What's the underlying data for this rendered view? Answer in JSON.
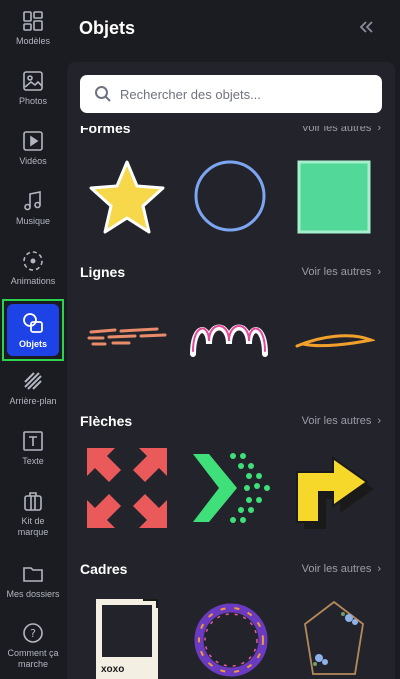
{
  "rail": [
    {
      "label": "Modèles",
      "icon": "grid-icon"
    },
    {
      "label": "Photos",
      "icon": "image-icon"
    },
    {
      "label": "Vidéos",
      "icon": "play-icon"
    },
    {
      "label": "Musique",
      "icon": "music-icon"
    },
    {
      "label": "Animations",
      "icon": "animation-icon"
    },
    {
      "label": "Objets",
      "icon": "shapes-icon",
      "active": true
    },
    {
      "label": "Arrière-plan",
      "icon": "stripes-icon"
    },
    {
      "label": "Texte",
      "icon": "text-icon"
    },
    {
      "label": "Kit de marque",
      "icon": "briefcase-icon"
    },
    {
      "label": "Mes dossiers",
      "icon": "folder-icon"
    },
    {
      "label": "Comment ça marche",
      "icon": "help-icon"
    }
  ],
  "panel": {
    "title": "Objets",
    "collapse_icon": "double-chevron-left-icon",
    "search_placeholder": "Rechercher des objets...",
    "sections": [
      {
        "title": "Formes",
        "see_all": "Voir les autres"
      },
      {
        "title": "Lignes",
        "see_all": "Voir les autres"
      },
      {
        "title": "Flèches",
        "see_all": "Voir les autres"
      },
      {
        "title": "Cadres",
        "see_all": "Voir les autres"
      }
    ]
  },
  "colors": {
    "accent": "#1d43e6",
    "highlight": "#2bd44a",
    "panel": "#23242b",
    "background": "#1b1c22"
  }
}
